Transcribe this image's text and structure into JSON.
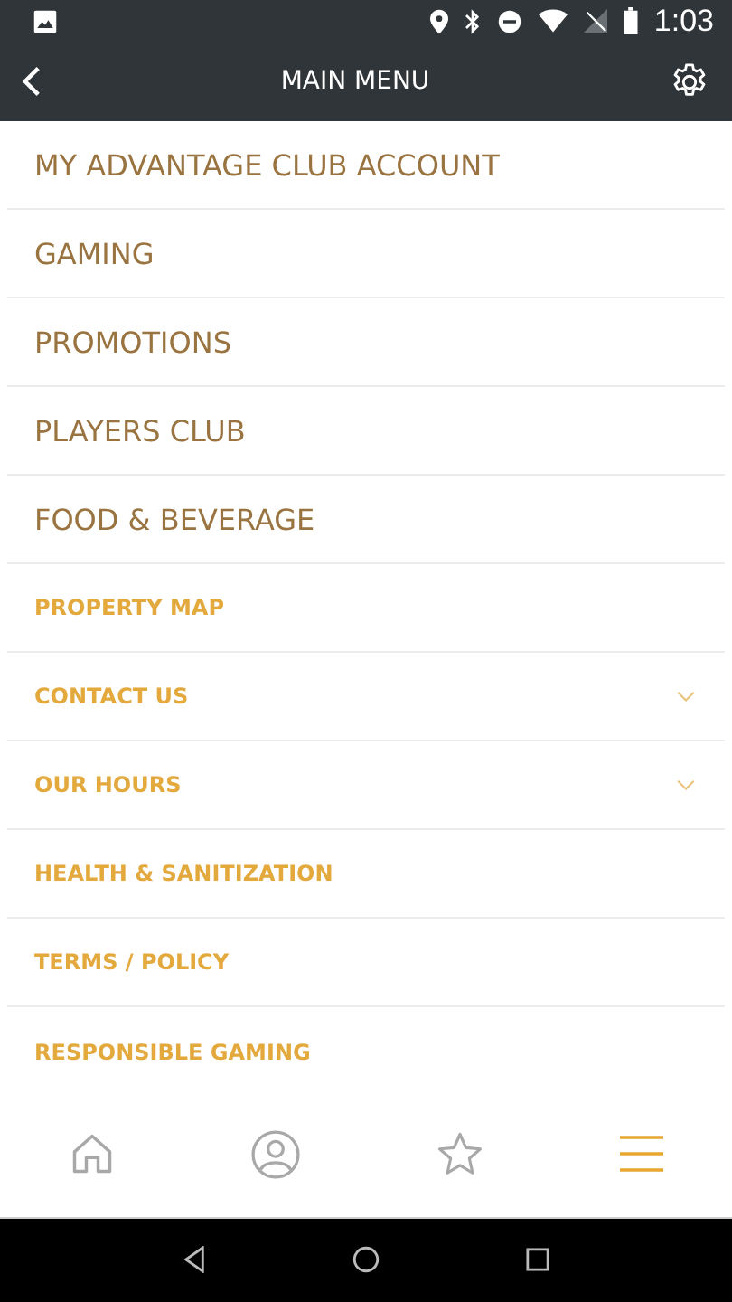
{
  "status_bar": {
    "time": "1:03"
  },
  "header": {
    "title": "MAIN MENU"
  },
  "menu": [
    {
      "label": "MY ADVANTAGE CLUB ACCOUNT",
      "kind": "main"
    },
    {
      "label": "GAMING",
      "kind": "main"
    },
    {
      "label": "PROMOTIONS",
      "kind": "main"
    },
    {
      "label": "PLAYERS CLUB",
      "kind": "main"
    },
    {
      "label": "FOOD & BEVERAGE",
      "kind": "main"
    },
    {
      "label": "PROPERTY MAP",
      "kind": "sub"
    },
    {
      "label": "CONTACT US",
      "kind": "expandable"
    },
    {
      "label": "OUR HOURS",
      "kind": "expandable"
    },
    {
      "label": "HEALTH & SANITIZATION",
      "kind": "sub"
    },
    {
      "label": "TERMS / POLICY",
      "kind": "sub"
    },
    {
      "label": "RESPONSIBLE GAMING",
      "kind": "sub"
    }
  ],
  "bottom_nav": [
    {
      "kind": "home",
      "selected": false
    },
    {
      "kind": "profile",
      "selected": false
    },
    {
      "kind": "favorites",
      "selected": false
    },
    {
      "kind": "menu",
      "selected": true
    }
  ]
}
